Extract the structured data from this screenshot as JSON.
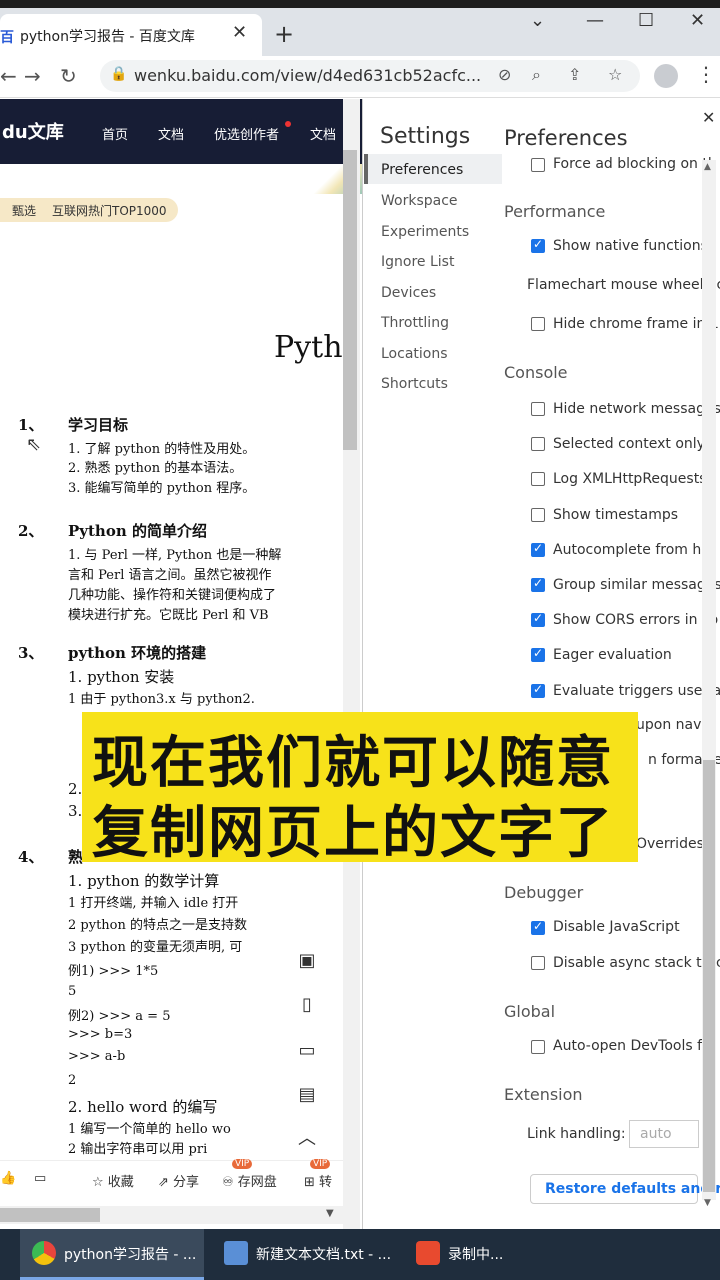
{
  "browser": {
    "tab_title": "python学习报告 - 百度文库",
    "tab_favicon": "百",
    "tab_close": "✕",
    "new_tab": "+",
    "url": "wenku.baidu.com/view/d4ed631cb52acfc...",
    "win_min": "—",
    "win_max": "☐",
    "win_close": "✕",
    "chevron": "⌄",
    "back": "←",
    "forward": "→",
    "reload": "↻",
    "lock": "🔒",
    "kebab": "⋮"
  },
  "wenku": {
    "logo": "du文库",
    "nav": [
      "首页",
      "文档",
      "优选创作者",
      "文档"
    ],
    "pill": [
      "甄选",
      "互联网热门TOP1000"
    ],
    "doc_title": "Pytho",
    "sections": [
      {
        "num": "1、",
        "title": "学习目标",
        "lines": [
          "1.  了解 python 的特性及用处。",
          "2.  熟悉 python 的基本语法。",
          "3.  能编写简单的 python 程序。"
        ]
      },
      {
        "num": "2、",
        "title": "Python 的简单介绍",
        "lines": [
          "1.  与 Perl 一样,  Python 也是一种解",
          "    言和 Perl 语言之间。虽然它被视作",
          "    几种功能、操作符和关键词便构成了",
          "    模块进行扩充。它既比 Perl 和 VB"
        ]
      },
      {
        "num": "3、",
        "title": "python 环境的搭建",
        "lines": [
          "1.  python 安装",
          "    1    由于 python3.x 与 python2."
        ]
      },
      {
        "num": "4、",
        "title": "熟",
        "lines": [
          "1.  python 的数学计算",
          "    1   打开终端, 并输入 idle 打开",
          "    2   python 的特点之一是支持数",
          "    3   python 的变量无须声明, 可",
          "        例1)  >>> 1*5",
          "                5",
          "        例2)  >>> a = 5",
          "                >>> b=3",
          "                >>> a-b",
          "                2",
          "2.  hello word 的编写",
          "    1   编写一个简单的 hello wo",
          "    2   输出字符串可以用 pri"
        ]
      }
    ],
    "extra_nums": [
      "2.",
      "3."
    ],
    "bottom_bar": [
      "收藏",
      "分享",
      "存网盘",
      "转"
    ],
    "vip": "VIP"
  },
  "devtools": {
    "settings_title": "Settings",
    "page_title": "Preferences",
    "close": "✕",
    "nav": [
      "Preferences",
      "Workspace",
      "Experiments",
      "Ignore List",
      "Devices",
      "Throttling",
      "Locations",
      "Shortcuts"
    ],
    "top_item": "Force ad blocking on th",
    "performance": {
      "heading": "Performance",
      "show_native": "Show native functions i",
      "flamechart": "Flamechart mouse wheel ac",
      "hide_frame": "Hide chrome frame in L"
    },
    "console": {
      "heading": "Console",
      "items": [
        {
          "label": "Hide network messages",
          "on": false
        },
        {
          "label": "Selected context only",
          "on": false
        },
        {
          "label": "Log XMLHttpRequests",
          "on": false
        },
        {
          "label": "Show timestamps",
          "on": false
        },
        {
          "label": "Autocomplete from his",
          "on": true
        },
        {
          "label": "Group similar messages",
          "on": true
        },
        {
          "label": "Show CORS errors in co",
          "on": true
        },
        {
          "label": "Eager evaluation",
          "on": true
        },
        {
          "label": "Evaluate triggers user a",
          "on": true
        }
      ],
      "partial1": "upon navi",
      "partial2": "n formatte",
      "partial3": "Overrides"
    },
    "debugger": {
      "heading": "Debugger",
      "disable_js": "Disable JavaScript",
      "disable_async": "Disable async stack trac"
    },
    "global": {
      "heading": "Global",
      "auto_open": "Auto-open DevTools fo"
    },
    "extension": {
      "heading": "Extension",
      "link_handling": "Link handling:",
      "select_value": "auto"
    },
    "restore": "Restore defaults and rel"
  },
  "caption": [
    "现在我们就可以随意",
    "复制网页上的文字了"
  ],
  "taskbar": [
    {
      "label": "python学习报告 - ...",
      "color": "#e8453c"
    },
    {
      "label": "新建文本文档.txt - ...",
      "color": "#5a8fd6"
    },
    {
      "label": "录制中...",
      "color": "#e84a2f"
    }
  ]
}
